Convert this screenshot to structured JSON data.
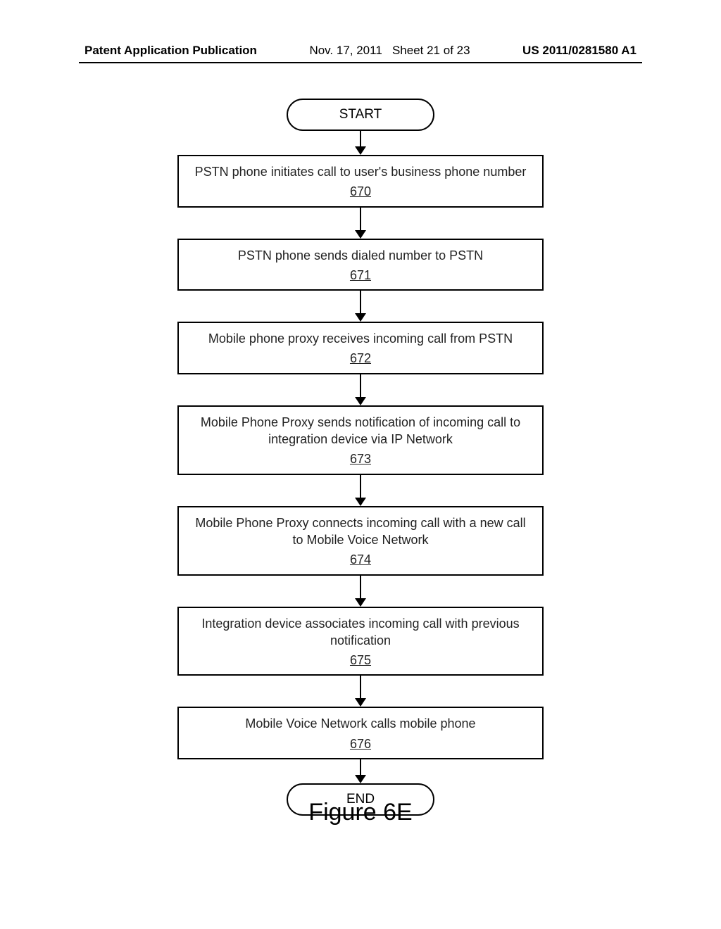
{
  "header": {
    "left": "Patent Application Publication",
    "date": "Nov. 17, 2011",
    "sheet": "Sheet 21 of 23",
    "pubnum": "US 2011/0281580 A1"
  },
  "flowchart": {
    "start": "START",
    "end": "END",
    "steps": [
      {
        "text": "PSTN phone initiates call to user's business phone number",
        "ref": "670"
      },
      {
        "text": "PSTN phone sends dialed number to PSTN",
        "ref": "671"
      },
      {
        "text": "Mobile phone proxy receives incoming call from PSTN",
        "ref": "672"
      },
      {
        "text": "Mobile Phone Proxy sends notification of incoming call to integration device via IP Network",
        "ref": "673"
      },
      {
        "text": "Mobile Phone Proxy connects incoming call with a new call to Mobile Voice Network",
        "ref": "674"
      },
      {
        "text": "Integration device associates incoming call with previous notification",
        "ref": "675"
      },
      {
        "text": "Mobile Voice Network calls mobile phone",
        "ref": "676"
      }
    ]
  },
  "caption": "Figure 6E"
}
